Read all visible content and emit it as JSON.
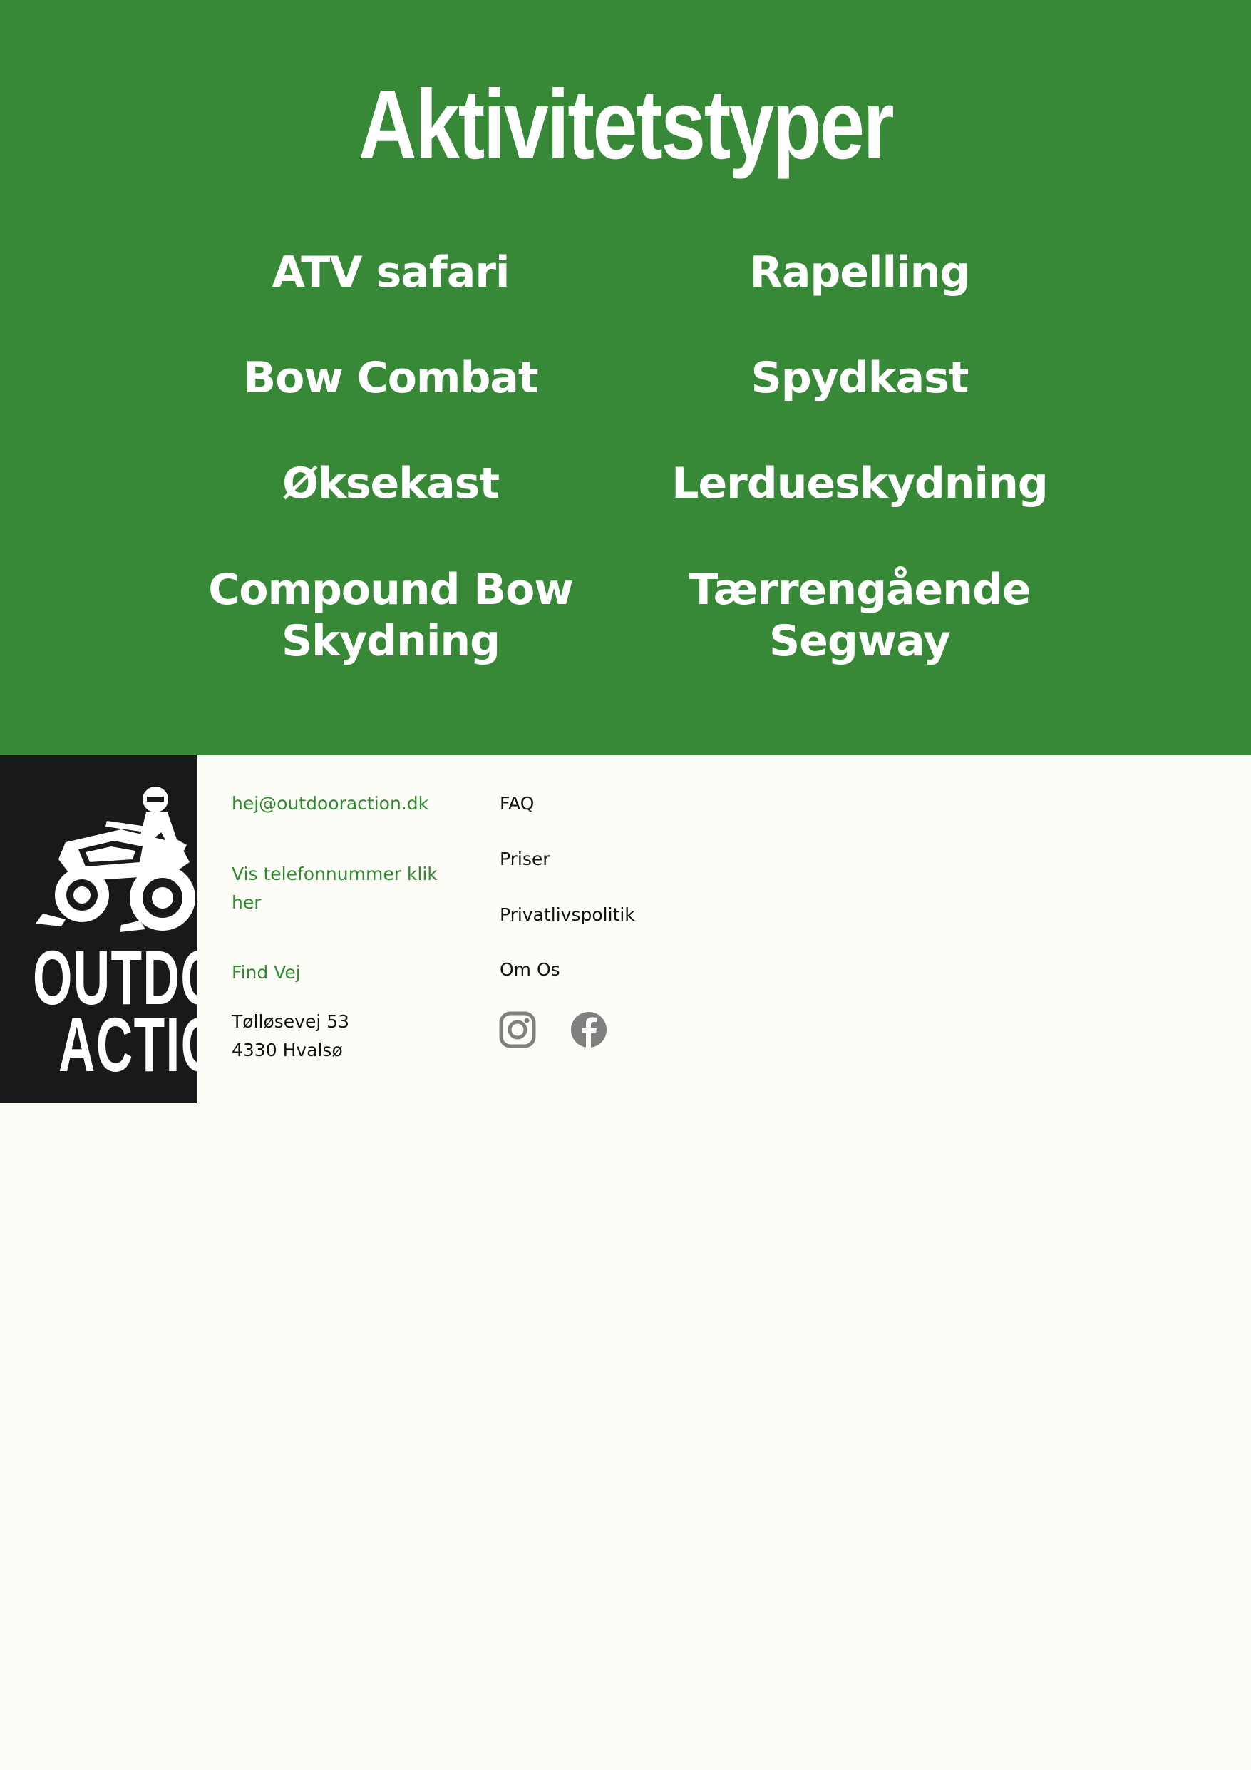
{
  "activities": {
    "heading": "Aktivitetstyper",
    "items": [
      "ATV safari",
      "Rapelling",
      "Bow Combat",
      "Spydkast",
      "Øksekast",
      "Lerdueskydning",
      "Compound Bow Skydning",
      "Tærrengående Segway"
    ]
  },
  "footer": {
    "logo": {
      "line1": "OUTDOOR",
      "line2": "ACTION"
    },
    "email": "hej@outdooraction.dk",
    "phone_link": "Vis telefonnummer klik her",
    "directions_link": "Find Vej",
    "address": {
      "street": "Tølløsevej 53",
      "city": "4330 Hvalsø"
    },
    "nav": [
      "FAQ",
      "Priser",
      "Privatlivspolitik",
      "Om Os"
    ],
    "social": [
      {
        "icon": "instagram-icon",
        "color": "#808080"
      },
      {
        "icon": "facebook-icon",
        "color": "#808080"
      }
    ]
  },
  "colors": {
    "green": "#388937",
    "link_green": "#2f8a2d",
    "page_bg": "#fdfdf8",
    "logo_bg": "#18191b"
  }
}
